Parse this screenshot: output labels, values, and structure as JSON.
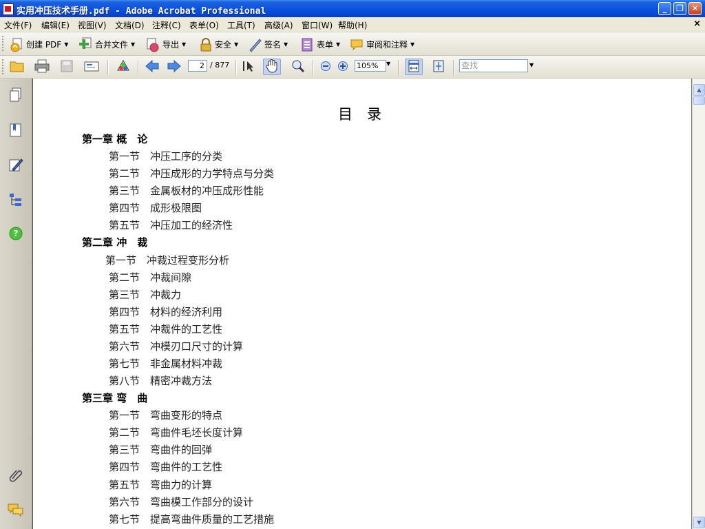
{
  "window": {
    "title": "实用冲压技术手册.pdf - Adobe Acrobat Professional",
    "minimize": "_",
    "maximize": "❐",
    "close": "✕"
  },
  "menubar": {
    "items": [
      "文件(F)",
      "编辑(E)",
      "视图(V)",
      "文档(D)",
      "注释(C)",
      "表单(O)",
      "工具(T)",
      "高级(A)",
      "窗口(W)",
      "帮助(H)"
    ],
    "close_glyph": "×"
  },
  "toolbar1": {
    "create_pdf": "创建 PDF",
    "combine_files": "合并文件",
    "export": "导出",
    "security": "安全",
    "sign": "签名",
    "forms": "表单",
    "review_comment": "审阅和注释"
  },
  "toolbar2": {
    "page_current": "2",
    "page_total": "/ 877",
    "zoom": "105%",
    "find_placeholder": "查找"
  },
  "document": {
    "heading": "目　录",
    "toc": [
      {
        "type": "chapter",
        "text": "第一章 概　论"
      },
      {
        "type": "section",
        "text": "第一节　冲压工序的分类"
      },
      {
        "type": "section",
        "text": "第二节　冲压成形的力学特点与分类"
      },
      {
        "type": "section",
        "text": "第三节　金属板材的冲压成形性能"
      },
      {
        "type": "section",
        "text": "第四节　成形极限图"
      },
      {
        "type": "section",
        "text": "第五节　冲压加工的经济性"
      },
      {
        "type": "chapter",
        "text": "第二章 冲　裁"
      },
      {
        "type": "section",
        "text": "第一节　冲裁过程变形分析"
      },
      {
        "type": "section",
        "text": "第二节　冲裁间隙"
      },
      {
        "type": "section",
        "text": "第三节　冲裁力"
      },
      {
        "type": "section",
        "text": "第四节　材料的经济利用"
      },
      {
        "type": "section",
        "text": "第五节　冲裁件的工艺性"
      },
      {
        "type": "section",
        "text": "第六节　冲模刃口尺寸的计算"
      },
      {
        "type": "section",
        "text": "第七节　非金属材料冲裁"
      },
      {
        "type": "section",
        "text": "第八节　精密冲裁方法"
      },
      {
        "type": "chapter",
        "text": "第三章 弯　曲"
      },
      {
        "type": "section",
        "text": "第一节　弯曲变形的特点"
      },
      {
        "type": "section",
        "text": "第二节　弯曲件毛坯长度计算"
      },
      {
        "type": "section",
        "text": "第三节　弯曲件的回弹"
      },
      {
        "type": "section",
        "text": "第四节　弯曲件的工艺性"
      },
      {
        "type": "section",
        "text": "第五节　弯曲力的计算"
      },
      {
        "type": "section",
        "text": "第六节　弯曲模工作部分的设计"
      },
      {
        "type": "section",
        "text": "第七节　提高弯曲件质量的工艺措施"
      }
    ]
  },
  "scrollbar": {
    "up": "▲",
    "down": "▼"
  }
}
